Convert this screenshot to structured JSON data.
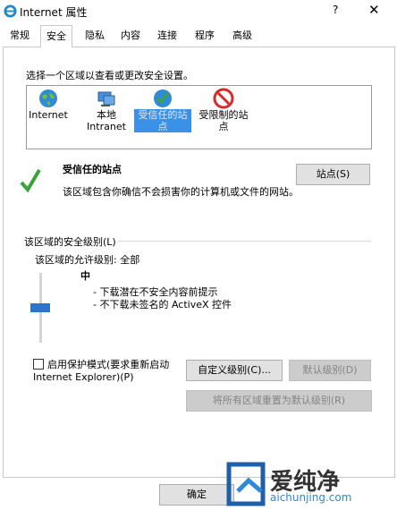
{
  "window": {
    "title": "Internet 属性",
    "help": "?",
    "close": "✕"
  },
  "tabs": [
    "常规",
    "安全",
    "隐私",
    "内容",
    "连接",
    "程序",
    "高级"
  ],
  "active_tab": "安全",
  "zones": {
    "prompt": "选择一个区域以查看或更改安全设置。",
    "items": [
      {
        "label": "Internet",
        "icon": "globe-icon"
      },
      {
        "label": "本地\nIntranet",
        "icon": "intranet-icon"
      },
      {
        "label": "受信任的站\n点",
        "icon": "check-globe-icon",
        "selected": true
      },
      {
        "label": "受限制的站\n点",
        "icon": "no-entry-icon"
      }
    ]
  },
  "selected_zone": {
    "title": "受信任的站点",
    "description": "该区域包含你确信不会损害你的计算机或文件的网站。",
    "sites_button": "站点(S)",
    "icon": "checkmark-icon"
  },
  "security_level": {
    "group_label": "该区域的安全级别(L)",
    "allowed": "该区域的允许级别: 全部",
    "level_name": "中",
    "bullets": [
      "- 下载潜在不安全内容前提示",
      "- 不下载未签名的 ActiveX 控件"
    ],
    "slider_level": 0.5
  },
  "protected_mode": {
    "label": "启用保护模式(要求重新启动\nInternet Explorer)(P)",
    "checked": false
  },
  "buttons": {
    "custom_level": "自定义级别(C)...",
    "default_level": "默认级别(D)",
    "reset_all": "将所有区域重置为默认级别(R)",
    "ok": "确定"
  },
  "watermark": {
    "text": "爱纯净",
    "url": "aichunjing.com"
  },
  "colors": {
    "accent": "#2b74c9",
    "selection": "#3a91e6",
    "disabled_button": "#cccccc"
  }
}
